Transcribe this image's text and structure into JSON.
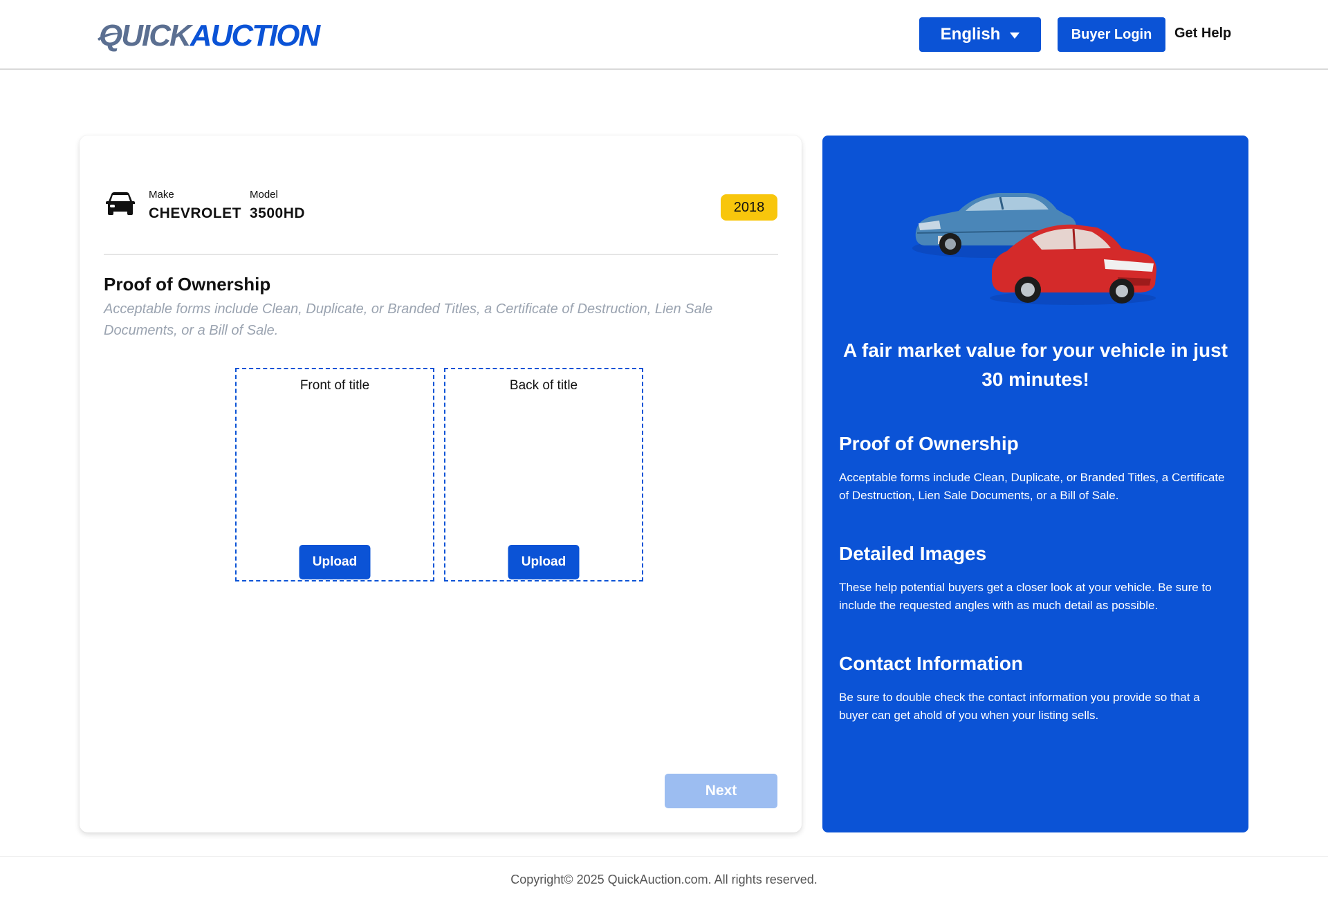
{
  "header": {
    "logo_part1": "QUICK",
    "logo_part2": "AUCTION",
    "language": "English",
    "buyer_login": "Buyer Login",
    "get_help": "Get Help"
  },
  "vehicle": {
    "make_label": "Make",
    "make": "CHEVROLET",
    "model_label": "Model",
    "model": "3500HD",
    "year": "2018"
  },
  "form": {
    "title": "Proof of Ownership",
    "description": "Acceptable forms include Clean, Duplicate, or Branded Titles, a Certificate of Destruction, Lien Sale Documents, or a Bill of Sale.",
    "front_label": "Front of title",
    "back_label": "Back of title",
    "upload_label": "Upload",
    "next_label": "Next"
  },
  "panel": {
    "tagline": "A fair market value for your vehicle in just 30 minutes!",
    "sections": [
      {
        "heading": "Proof of Ownership",
        "text": "Acceptable forms include Clean, Duplicate, or Branded Titles, a Certificate of Destruction, Lien Sale Documents, or a Bill of Sale."
      },
      {
        "heading": "Detailed Images",
        "text": "These help potential buyers get a closer look at your vehicle. Be sure to include the requested angles with as much detail as possible."
      },
      {
        "heading": "Contact Information",
        "text": "Be sure to double check the contact information you provide so that a buyer can get ahold of you when your listing sells."
      }
    ]
  },
  "footer": {
    "copyright": "Copyright© 2025 QuickAuction.com. All rights reserved."
  },
  "colors": {
    "brand_blue": "#0b53d6",
    "badge_yellow": "#f8c60c",
    "disabled_button": "#9cbdf1",
    "logo_gray": "#5b6f91"
  },
  "icons": [
    "car-icon",
    "caret-down-icon"
  ]
}
